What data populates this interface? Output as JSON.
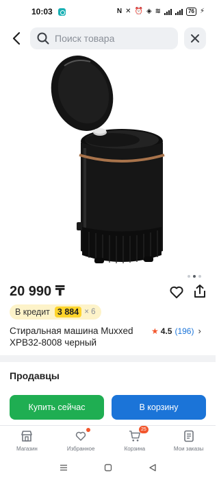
{
  "status_bar": {
    "time": "10:03",
    "battery": "76"
  },
  "search": {
    "placeholder": "Поиск товара"
  },
  "product": {
    "price": "20 990 ₸",
    "credit_label": "В кредит",
    "credit_amount": "3 884",
    "credit_months": "× 6",
    "title": "Стиральная машина Muxxed XPB32-8008 черный",
    "rating": "4.5",
    "reviews": "(196)",
    "image_slide": 2,
    "image_slides_total": 3
  },
  "sellers": {
    "heading": "Продавцы"
  },
  "actions": {
    "buy_now": "Купить сейчас",
    "add_to_cart": "В корзину"
  },
  "bottom_nav": {
    "items": [
      {
        "label": "Магазин",
        "icon": "shop-icon"
      },
      {
        "label": "Избранное",
        "icon": "heart-icon"
      },
      {
        "label": "Корзина",
        "icon": "cart-icon",
        "badge": "25"
      },
      {
        "label": "Мои заказы",
        "icon": "orders-icon"
      }
    ]
  },
  "colors": {
    "buy_button": "#1fae52",
    "cart_button": "#1b74d8",
    "badge": "#f2562d",
    "credit_highlight": "#fed42b",
    "rating_count": "#1a74d9"
  }
}
